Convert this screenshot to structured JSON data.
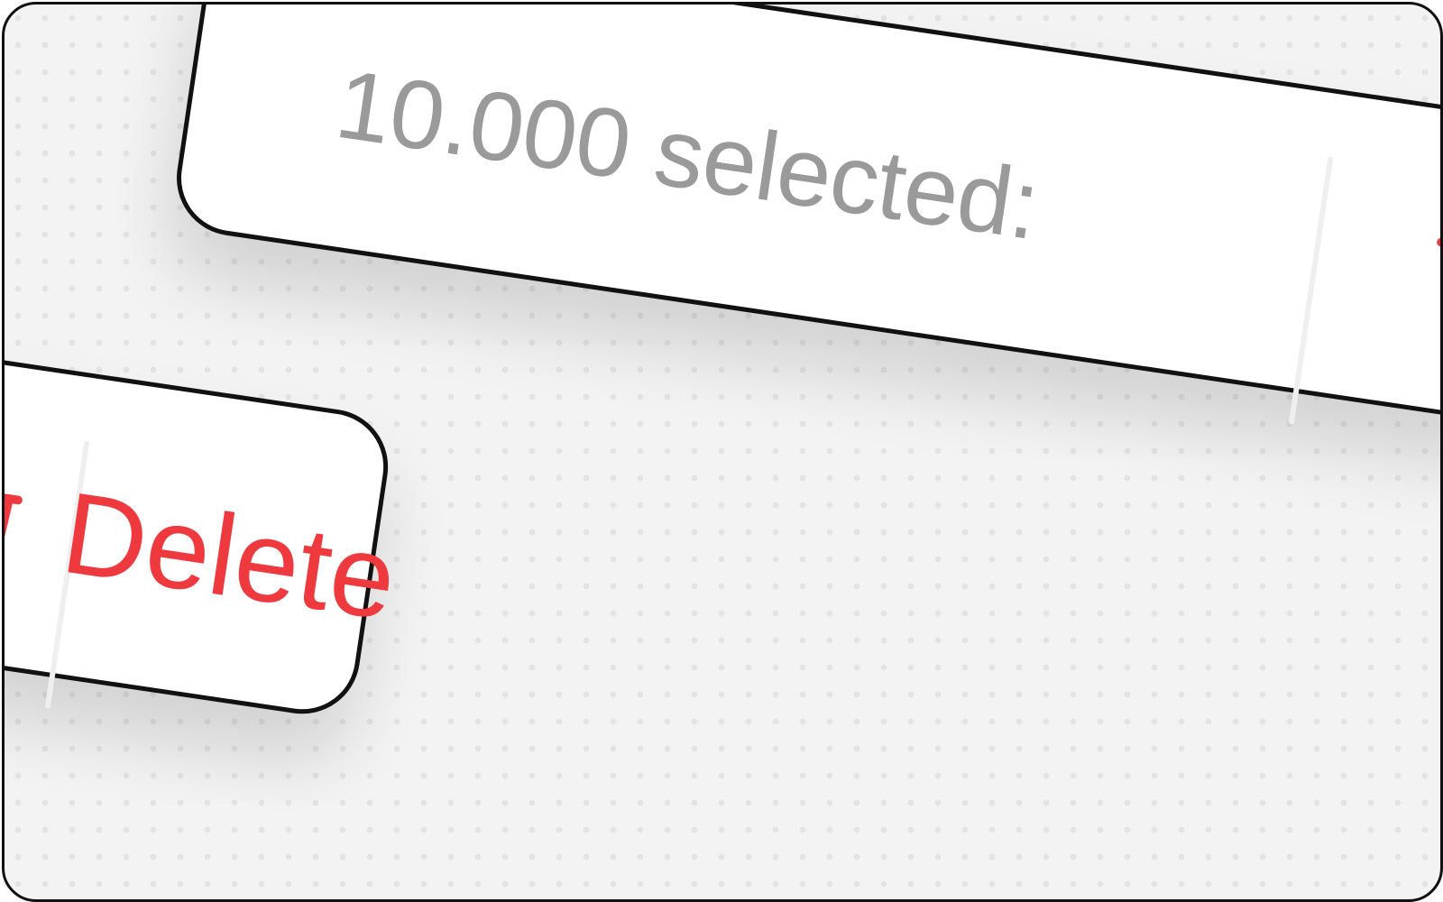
{
  "selection_bar": {
    "count_text": "10.000 selected:",
    "action": {
      "icon": "trash-icon",
      "label": "Delete",
      "color": "#ee3a3e"
    }
  },
  "colors": {
    "count_text": "#9a9a9a",
    "divider": "#efefef",
    "bar_border": "#111111",
    "background": "#f3f3f3"
  }
}
